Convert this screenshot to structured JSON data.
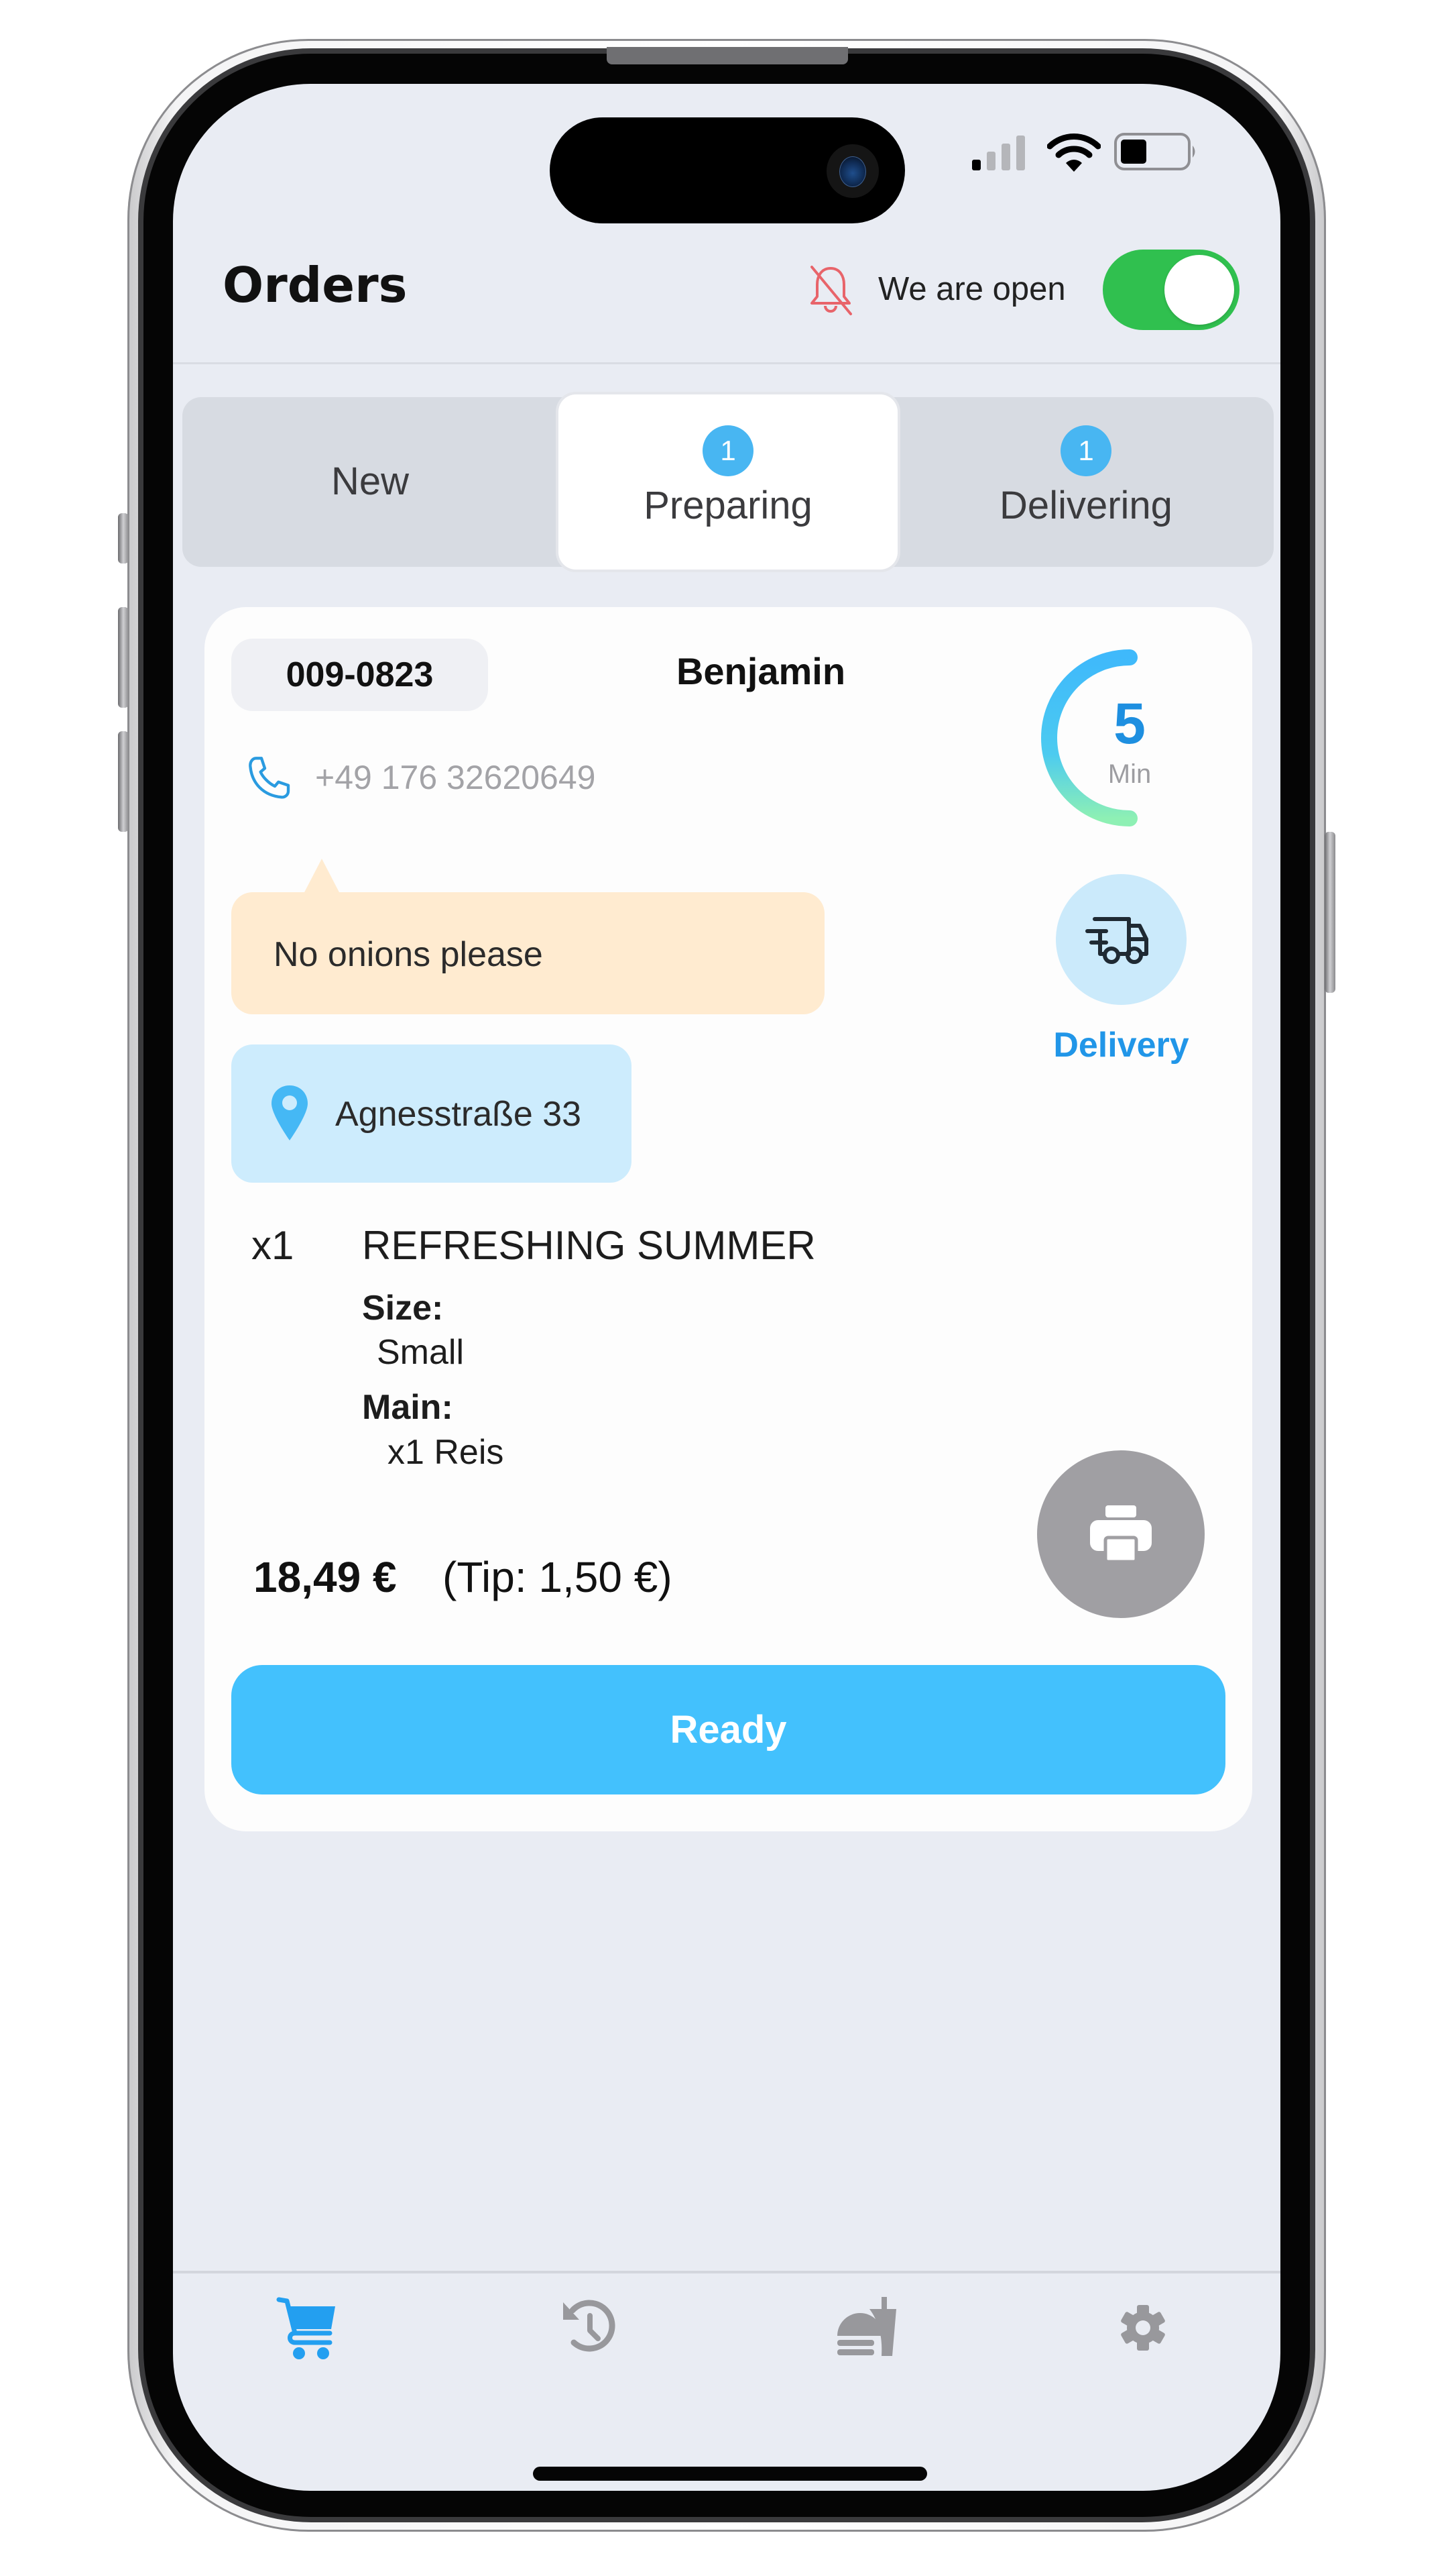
{
  "status_bar": {
    "signal_bars_active": 1,
    "signal_bars_total": 4,
    "wifi_icon": "wifi-icon",
    "battery_level_percent": 40
  },
  "header": {
    "title": "Orders",
    "notification_icon": "bell-off-icon",
    "open_label": "We are open",
    "open_toggle_on": true
  },
  "tabs": [
    {
      "label": "New",
      "badge": null,
      "active": false
    },
    {
      "label": "Preparing",
      "badge": "1",
      "active": true
    },
    {
      "label": "Delivering",
      "badge": "1",
      "active": false
    }
  ],
  "order": {
    "number": "009-0823",
    "customer": "Benjamin",
    "phone": "+49 176 32620649",
    "timer": {
      "value": "5",
      "unit": "Min",
      "progress_fraction": 0.5
    },
    "note": "No onions please",
    "type_label": "Delivery",
    "type_icon": "delivery-truck-icon",
    "address": "Agnesstraße 33",
    "items": [
      {
        "qty": "x1",
        "name": "REFRESHING SUMMER",
        "options": [
          {
            "label": "Size:",
            "value": "Small"
          },
          {
            "label": "Main:",
            "value": "x1 Reis"
          }
        ]
      }
    ],
    "total": "18,49 €",
    "tip": "(Tip: 1,50 €)",
    "print_icon": "printer-icon",
    "ready_label": "Ready"
  },
  "bottom_nav": [
    {
      "icon": "cart-icon",
      "active": true
    },
    {
      "icon": "history-icon",
      "active": false
    },
    {
      "icon": "menu-food-icon",
      "active": false
    },
    {
      "icon": "settings-gear-icon",
      "active": false
    }
  ],
  "colors": {
    "accent_blue": "#43c1fd",
    "badge_blue": "#48b6f2",
    "label_blue": "#2196e8",
    "toggle_green": "#30c04f",
    "note_bg": "#ffebd0",
    "address_bg": "#cdecfd",
    "bell_red": "#e8646a",
    "icon_gray": "#98989c"
  }
}
